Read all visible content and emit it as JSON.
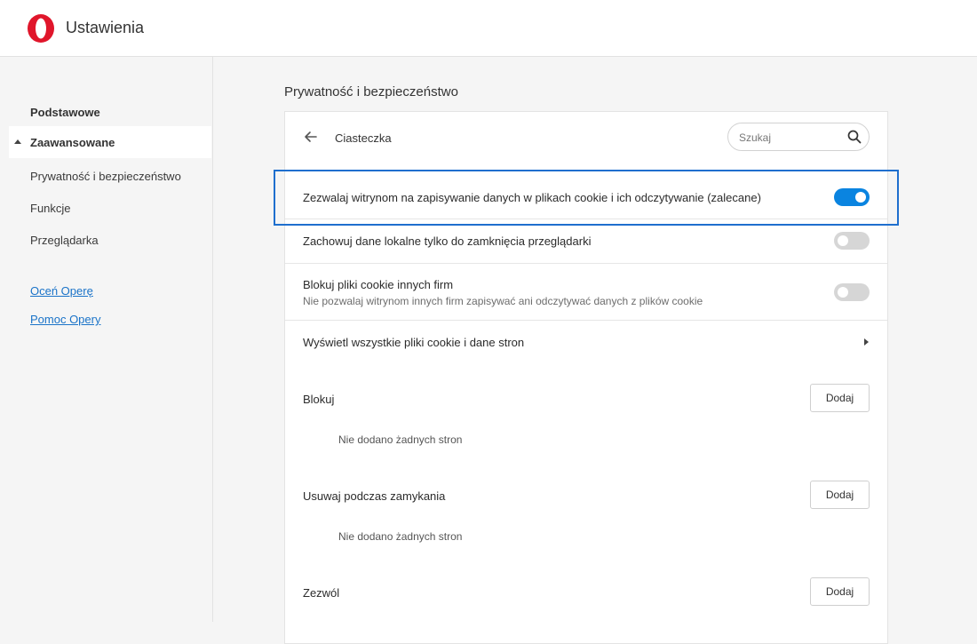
{
  "app": {
    "title": "Ustawienia"
  },
  "sidebar": {
    "items": [
      {
        "label": "Podstawowe"
      },
      {
        "label": "Zaawansowane"
      },
      {
        "label": "Prywatność i bezpieczeństwo"
      },
      {
        "label": "Funkcje"
      },
      {
        "label": "Przeglądarka"
      }
    ],
    "links": [
      {
        "label": "Oceń Operę"
      },
      {
        "label": "Pomoc Opery"
      }
    ]
  },
  "main": {
    "section_title": "Prywatność i bezpieczeństwo",
    "card": {
      "title": "Ciasteczka",
      "search_placeholder": "Szukaj",
      "settings": [
        {
          "label": "Zezwalaj witrynom na zapisywanie danych w plikach cookie i ich odczytywanie (zalecane)",
          "enabled": true
        },
        {
          "label": "Zachowuj dane lokalne tylko do zamknięcia przeglądarki",
          "enabled": false
        },
        {
          "label": "Blokuj pliki cookie innych firm",
          "sublabel": "Nie pozwalaj witrynom innych firm zapisywać ani odczytywać danych z plików cookie",
          "enabled": false
        }
      ],
      "view_all_label": "Wyświetl wszystkie pliki cookie i dane stron",
      "lists": [
        {
          "label": "Blokuj",
          "button": "Dodaj",
          "empty": "Nie dodano żadnych stron"
        },
        {
          "label": "Usuwaj podczas zamykania",
          "button": "Dodaj",
          "empty": "Nie dodano żadnych stron"
        },
        {
          "label": "Zezwól",
          "button": "Dodaj"
        }
      ]
    }
  },
  "colors": {
    "accent": "#0a84e0",
    "link": "#1a73c8",
    "highlight_border": "#1f6fce",
    "opera_red": "#e0162b"
  }
}
